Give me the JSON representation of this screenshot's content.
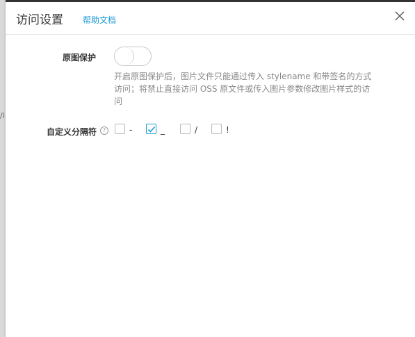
{
  "backdrop": {
    "fragment": "/l"
  },
  "dialog": {
    "title": "访问设置",
    "help_link": "帮助文档"
  },
  "original_protection": {
    "label": "原图保护",
    "enabled": false,
    "description": "开启原图保护后，图片文件只能通过传入 stylename 和带签名的方式访问；将禁止直接访问 OSS 原文件或传入图片参数修改图片样式的访问"
  },
  "separator": {
    "label": "自定义分隔符",
    "help_icon": "?",
    "options": [
      {
        "label": "-",
        "checked": false
      },
      {
        "label": "_",
        "checked": true
      },
      {
        "label": "/",
        "checked": false
      },
      {
        "label": "!",
        "checked": false
      }
    ]
  },
  "colors": {
    "accent": "#1a9ad6",
    "text": "#333333",
    "muted": "#888888"
  }
}
